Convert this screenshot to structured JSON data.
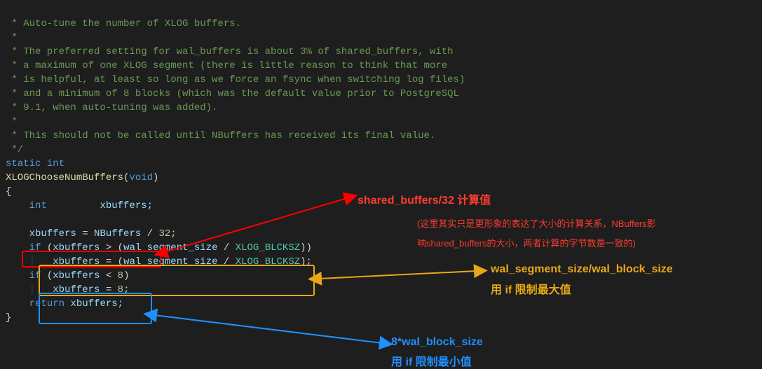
{
  "code": {
    "c1": " * Auto-tune the number of XLOG buffers.",
    "c2": " *",
    "c3": " * The preferred setting for wal_buffers is about 3% of shared_buffers, with",
    "c4": " * a maximum of one XLOG segment (there is little reason to think that more",
    "c5": " * is helpful, at least so long as we force an fsync when switching log files)",
    "c6": " * and a minimum of 8 blocks (which was the default value prior to PostgreSQL",
    "c7": " * 9.1, when auto-tuning was added).",
    "c8": " *",
    "c9": " * This should not be called until NBuffers has received its final value.",
    "c10": " */",
    "kw_static": "static",
    "kw_int": "int",
    "fn_name": "XLOGChooseNumBuffers",
    "kw_void": "void",
    "brace_open": "{",
    "decl_int": "int",
    "decl_var": "xbuffers;",
    "l_xbuffers": "xbuffers",
    "l_nbuffers": "NBuffers",
    "n32": "32",
    "kw_if1": "if",
    "wal_seg": "wal_segment_size",
    "xlog_blk": "XLOG_BLCKSZ",
    "kw_if2": "if",
    "n8": "8",
    "kw_return": "return",
    "ret_var": "xbuffers;",
    "brace_close": "}"
  },
  "annotations": {
    "red_title": "shared_buffers/32  计算值",
    "red_sub1": "(这里其实只是更形象的表达了大小的计算关系，NBuffers影",
    "red_sub2": "响shared_buffers的大小，两者计算的字节数是一致的)",
    "orange_l1": "wal_segment_size/wal_block_size",
    "orange_l2": "用 if 限制最大值",
    "blue_l1": "8*wal_block_size",
    "blue_l2": "用 if 限制最小值"
  }
}
